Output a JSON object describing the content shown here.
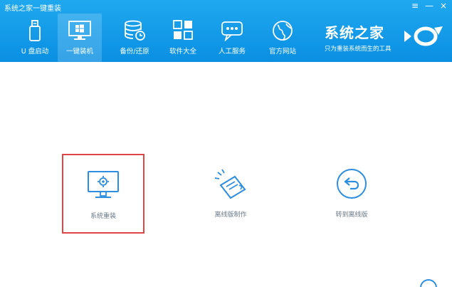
{
  "window": {
    "title": "系统之家一键重装",
    "menu_glyph": "≡",
    "min_glyph": "—",
    "close_glyph": "×"
  },
  "nav": {
    "items": [
      {
        "label": "U 盘启动",
        "icon": "usb-drive-icon"
      },
      {
        "label": "一键装机",
        "icon": "monitor-windows-icon",
        "active": true
      },
      {
        "label": "备份/还原",
        "icon": "database-restore-icon"
      },
      {
        "label": "软件大全",
        "icon": "apps-grid-icon"
      },
      {
        "label": "人工服务",
        "icon": "chat-bubble-icon"
      },
      {
        "label": "官方网站",
        "icon": "globe-icon"
      }
    ]
  },
  "brand": {
    "title": "系统之家",
    "subtitle": "只为重装系统而生的工具"
  },
  "options": [
    {
      "label": "系统重装",
      "icon": "monitor-gear-icon",
      "selected": true
    },
    {
      "label": "离线版制作",
      "icon": "network-card-icon",
      "selected": false
    },
    {
      "label": "转到离线版",
      "icon": "back-arrow-circle-icon",
      "selected": false
    }
  ],
  "colors": {
    "header": "#0a8fe2",
    "accent": "#2d8ee0",
    "selection_border": "#e04545",
    "label_text": "#6a7a88"
  }
}
